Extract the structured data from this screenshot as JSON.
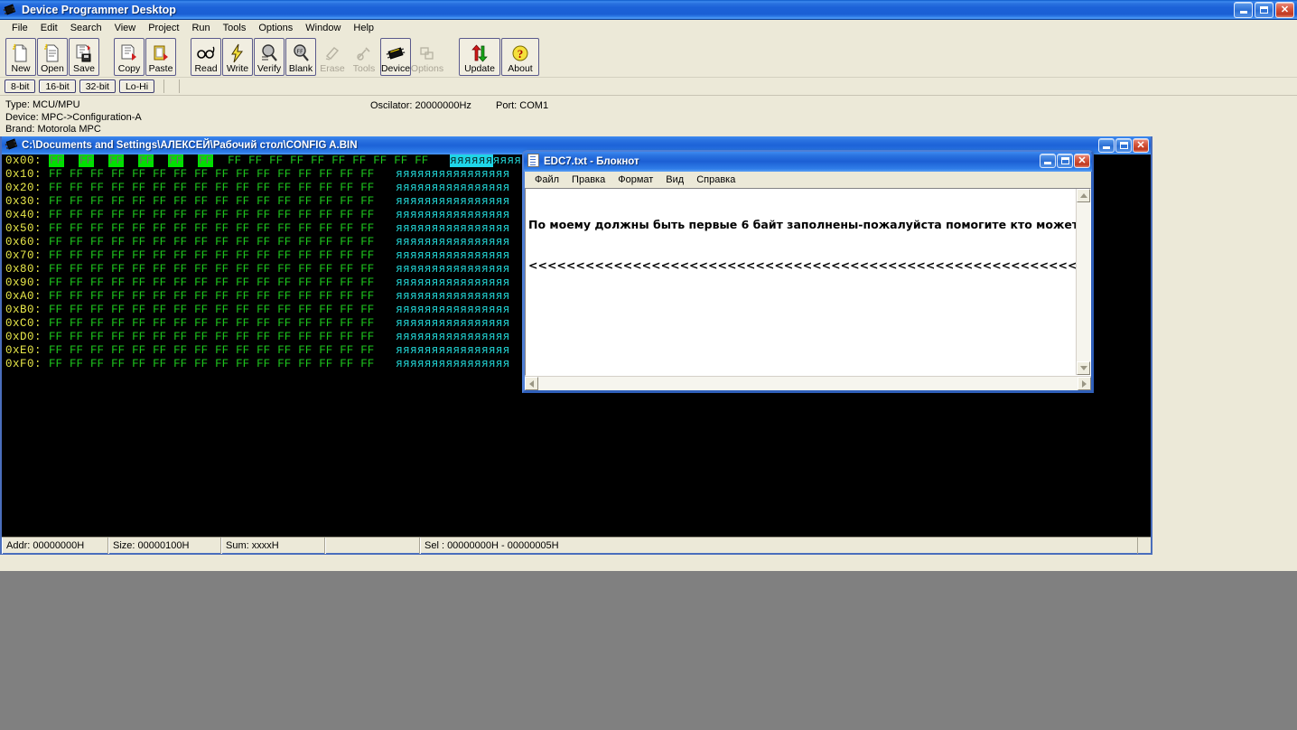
{
  "app": {
    "title": "Device Programmer Desktop",
    "icon": "chip-icon",
    "window_buttons": [
      "minimize",
      "maximize",
      "close"
    ],
    "menus": [
      {
        "label": "File"
      },
      {
        "label": "Edit"
      },
      {
        "label": "Search"
      },
      {
        "label": "View"
      },
      {
        "label": "Project"
      },
      {
        "label": "Run"
      },
      {
        "label": "Tools"
      },
      {
        "label": "Options"
      },
      {
        "label": "Window"
      },
      {
        "label": "Help"
      }
    ],
    "toolbar": {
      "groups": [
        [
          {
            "label": "New",
            "icon": "new-file-icon",
            "state": "normal"
          },
          {
            "label": "Open",
            "icon": "open-file-icon",
            "state": "normal"
          },
          {
            "label": "Save",
            "icon": "save-icon",
            "state": "normal"
          }
        ],
        [
          {
            "label": "Copy",
            "icon": "copy-icon",
            "state": "normal"
          },
          {
            "label": "Paste",
            "icon": "paste-icon",
            "state": "normal"
          }
        ],
        [
          {
            "label": "Read",
            "icon": "read-glasses-icon",
            "state": "normal"
          },
          {
            "label": "Write",
            "icon": "write-lightning-icon",
            "state": "normal"
          },
          {
            "label": "Verify",
            "icon": "verify-magnifier-icon",
            "state": "normal"
          },
          {
            "label": "Blank",
            "icon": "blank-magnifier-icon",
            "state": "normal"
          },
          {
            "label": "Erase",
            "icon": "erase-icon",
            "state": "disabled"
          },
          {
            "label": "Tools",
            "icon": "tools-icon",
            "state": "disabled"
          },
          {
            "label": "Device",
            "icon": "device-chip-icon",
            "state": "raised"
          },
          {
            "label": "Options",
            "icon": "options-icon",
            "state": "disabled"
          },
          {
            "label": "Update",
            "icon": "update-arrows-icon",
            "state": "raised"
          },
          {
            "label": "About",
            "icon": "about-question-icon",
            "state": "raised"
          }
        ]
      ]
    },
    "bitbar": {
      "buttons": [
        {
          "label": "8-bit"
        },
        {
          "label": "16-bit"
        },
        {
          "label": "32-bit"
        },
        {
          "label": "Lo-Hi"
        }
      ]
    },
    "device_info": {
      "type": "Type: MCU/MPU",
      "device": "Device: MPC->Configuration-A",
      "brand": "Brand: Motorola MPC",
      "oscilator": "Oscilator: 20000000Hz",
      "port": "Port: COM1"
    }
  },
  "hex_window": {
    "title": "C:\\Documents and Settings\\АЛЕКСЕЙ\\Рабочий стол\\CONFIG A.BIN",
    "icon": "chip-icon",
    "byte_value": "FF",
    "ascii_char": "я",
    "bytes_per_row": 16,
    "selected_count": 6,
    "offsets": [
      "0x00:",
      "0x10:",
      "0x20:",
      "0x30:",
      "0x40:",
      "0x50:",
      "0x60:",
      "0x70:",
      "0x80:",
      "0x90:",
      "0xA0:",
      "0xB0:",
      "0xC0:",
      "0xD0:",
      "0xE0:",
      "0xF0:"
    ],
    "status": {
      "addr": "Addr: 00000000H",
      "size": "Size: 00000100H",
      "sum": "Sum: xxxxH",
      "blank": "",
      "sel": "Sel : 00000000H - 00000005H"
    }
  },
  "notepad": {
    "title": "EDC7.txt - Блокнот",
    "icon": "notepad-icon",
    "menus": [
      {
        "label": "Файл"
      },
      {
        "label": "Правка"
      },
      {
        "label": "Формат"
      },
      {
        "label": "Вид"
      },
      {
        "label": "Справка"
      }
    ],
    "content_line1": "По моему должны быть первые 6 байт заполнены-пожалуйста помогите кто может)))",
    "content_line2": "<<<<<<<<<<<<<<<<<<<<<<<<<<<<<<<<<<<<<<<<<<<<<<<<<<<<<<<<<<<<<<<———————————",
    "scrollbars": {
      "v_up": "scroll-up-arrow",
      "v_down": "scroll-down-arrow",
      "h_left": "scroll-left-arrow",
      "h_right": "scroll-right-arrow"
    }
  },
  "colors": {
    "titlebar_blue": "#1c62d8",
    "face": "#ece9d8",
    "hex_offset": "#e8e84a",
    "hex_byte": "#1ec71e",
    "hex_selection": "#00e000",
    "ascii": "#22d5d5",
    "ascii_selection": "#1fd5e8",
    "desktop": "#808080"
  }
}
